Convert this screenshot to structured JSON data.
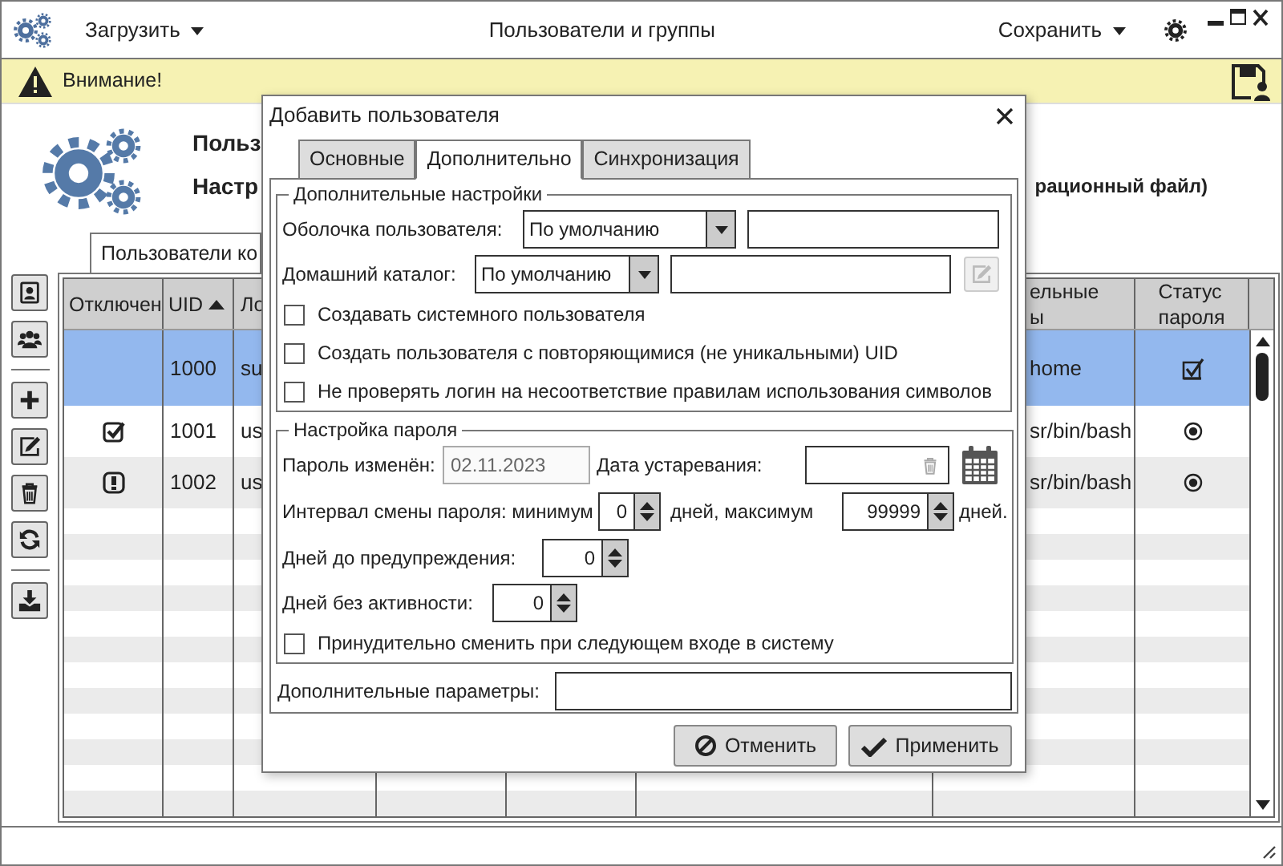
{
  "app_bar": {
    "load_menu": "Загрузить",
    "title": "Пользователи и группы",
    "save_menu": "Сохранить"
  },
  "notice": {
    "text": "Внимание!"
  },
  "header": {
    "title": "Польз",
    "subtitle": "Настр",
    "subtitle_tail": "рационный файл)"
  },
  "tabs": [
    {
      "label": "Пользователи ко",
      "selected": true
    }
  ],
  "table": {
    "columns": [
      {
        "label": "Отключен"
      },
      {
        "label": "UID",
        "sort_ascending": true
      },
      {
        "label": "Ло"
      },
      {
        "label": "ельные ы"
      },
      {
        "label": "Статус пароля"
      }
    ],
    "rows": [
      {
        "selected": true,
        "disabled": false,
        "warning": false,
        "uid": "1000",
        "column_3": "su",
        "column_8": "home",
        "password_checked": true
      },
      {
        "selected": false,
        "disabled": true,
        "warning": false,
        "uid": "1001",
        "column_3": "us",
        "column_8": "sr/bin/bash",
        "password_checked": false
      },
      {
        "selected": false,
        "disabled": false,
        "warning": true,
        "uid": "1002",
        "column_3": "us",
        "column_8": "sr/bin/bash",
        "password_checked": false
      }
    ]
  },
  "dialog": {
    "title": "Добавить пользователя",
    "tabs": [
      {
        "label": "Основные",
        "selected": false
      },
      {
        "label": "Дополнительно",
        "selected": true
      },
      {
        "label": "Синхронизация",
        "selected": false
      }
    ],
    "extra_settings": {
      "title": "Дополнительные настройки",
      "shell": {
        "label": "Оболочка пользователя:",
        "value": "По умолчанию"
      },
      "home": {
        "label": "Домашний каталог:",
        "value": "По умолчанию",
        "edit_disabled": true
      },
      "options": [
        {
          "label": "Создавать системного пользователя",
          "checked": false
        },
        {
          "label": "Создать пользователя с повторяющимися (не уникальными) UID",
          "checked": false
        },
        {
          "label": "Не проверять логин на несоответствие правилам использования символов",
          "checked": false
        }
      ]
    },
    "password": {
      "title": "Настройка пароля",
      "changed": {
        "label": "Пароль изменён:",
        "value": "02.11.2023",
        "disabled": true
      },
      "expiry": {
        "label": "Дата устаревания:"
      },
      "interval": {
        "label": "Интервал смены пароля: минимум",
        "min": "0",
        "middle": "дней, максимум",
        "max": "99999",
        "suffix": "дней."
      },
      "warn": {
        "label": "Дней до предупреждения:",
        "value": "0"
      },
      "inactive": {
        "label": "Дней без активности:",
        "value": "0"
      },
      "force_change": {
        "label": "Принудительно сменить при следующем входе в систему",
        "checked": false
      }
    },
    "extra_params": {
      "label": "Дополнительные параметры:"
    },
    "buttons": [
      {
        "label": "Отменить",
        "kind": "cancel"
      },
      {
        "label": "Применить",
        "kind": "apply"
      }
    ]
  }
}
